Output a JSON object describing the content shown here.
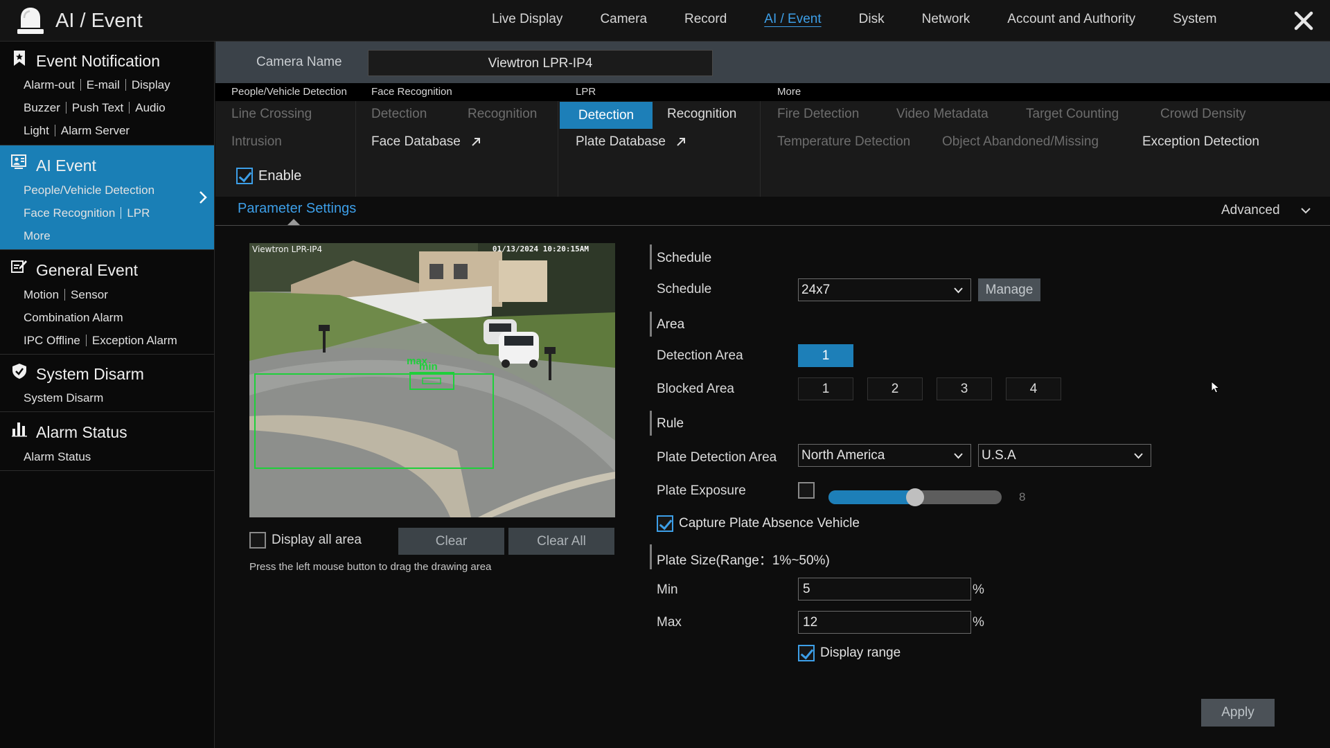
{
  "app": {
    "title": "AI / Event"
  },
  "topnav": [
    "Live Display",
    "Camera",
    "Record",
    "AI / Event",
    "Disk",
    "Network",
    "Account and Authority",
    "System"
  ],
  "topnav_active": "AI / Event",
  "sidebar": {
    "event_notification": {
      "title": "Event Notification",
      "rows": [
        [
          "Alarm-out",
          "E-mail",
          "Display"
        ],
        [
          "Buzzer",
          "Push Text",
          "Audio"
        ],
        [
          "Light",
          "Alarm Server"
        ]
      ]
    },
    "ai_event": {
      "title": "AI Event",
      "rows": [
        [
          "People/Vehicle Detection"
        ],
        [
          "Face Recognition",
          "LPR"
        ],
        [
          "More"
        ]
      ]
    },
    "general_event": {
      "title": "General Event",
      "rows": [
        [
          "Motion",
          "Sensor"
        ],
        [
          "Combination Alarm"
        ],
        [
          "IPC Offline",
          "Exception Alarm"
        ]
      ]
    },
    "system_disarm": {
      "title": "System Disarm",
      "rows": [
        [
          "System Disarm"
        ]
      ]
    },
    "alarm_status": {
      "title": "Alarm Status",
      "rows": [
        [
          "Alarm Status"
        ]
      ]
    }
  },
  "camera": {
    "label": "Camera Name",
    "value": "Viewtron LPR-IP4"
  },
  "subtabs": {
    "pvd": {
      "category": "People/Vehicle Detection",
      "tabs": [
        "Line Crossing",
        "Intrusion"
      ]
    },
    "face": {
      "category": "Face Recognition",
      "tabs": [
        "Detection",
        "Recognition",
        "Face Database"
      ]
    },
    "lpr": {
      "category": "LPR",
      "tabs": [
        "Detection",
        "Recognition",
        "Plate Database"
      ]
    },
    "more": {
      "category": "More",
      "tabs": [
        "Fire Detection",
        "Video Metadata",
        "Target Counting",
        "Crowd Density",
        "Temperature Detection",
        "Object Abandoned/Missing",
        "Exception Detection"
      ]
    }
  },
  "enable": {
    "label": "Enable",
    "checked": true
  },
  "parameter_settings": "Parameter Settings",
  "advanced": "Advanced",
  "preview": {
    "camera_name": "Viewtron LPR-IP4",
    "timestamp": "01/13/2024 10:20:15AM",
    "tag_max": "max",
    "tag_min": "min"
  },
  "display_all_area": {
    "label": "Display all area",
    "checked": false
  },
  "buttons": {
    "clear": "Clear",
    "clear_all": "Clear All",
    "manage": "Manage",
    "apply": "Apply"
  },
  "hint": "Press the left mouse button to drag the drawing area",
  "form": {
    "schedule_section": "Schedule",
    "schedule_label": "Schedule",
    "schedule_value": "24x7",
    "area_section": "Area",
    "detection_area_label": "Detection Area",
    "detection_areas": [
      "1"
    ],
    "blocked_area_label": "Blocked Area",
    "blocked_areas": [
      "1",
      "2",
      "3",
      "4"
    ],
    "rule_section": "Rule",
    "plate_detection_area_label": "Plate Detection Area",
    "region_value": "North America",
    "country_value": "U.S.A",
    "plate_exposure_label": "Plate Exposure",
    "plate_exposure_checked": false,
    "plate_exposure_value": "8",
    "plate_exposure_fraction": 0.5,
    "capture_absence": {
      "label": "Capture Plate Absence Vehicle",
      "checked": true
    },
    "plate_size_section": "Plate Size(Range：1%~50%)",
    "min_label": "Min",
    "min_value": "5",
    "max_label": "Max",
    "max_value": "12",
    "percent": "%",
    "display_range": {
      "label": "Display range",
      "checked": true
    }
  },
  "colors": {
    "accent": "#1d7fb8",
    "link": "#3d9fe8",
    "detection_box": "#1ed03a"
  }
}
